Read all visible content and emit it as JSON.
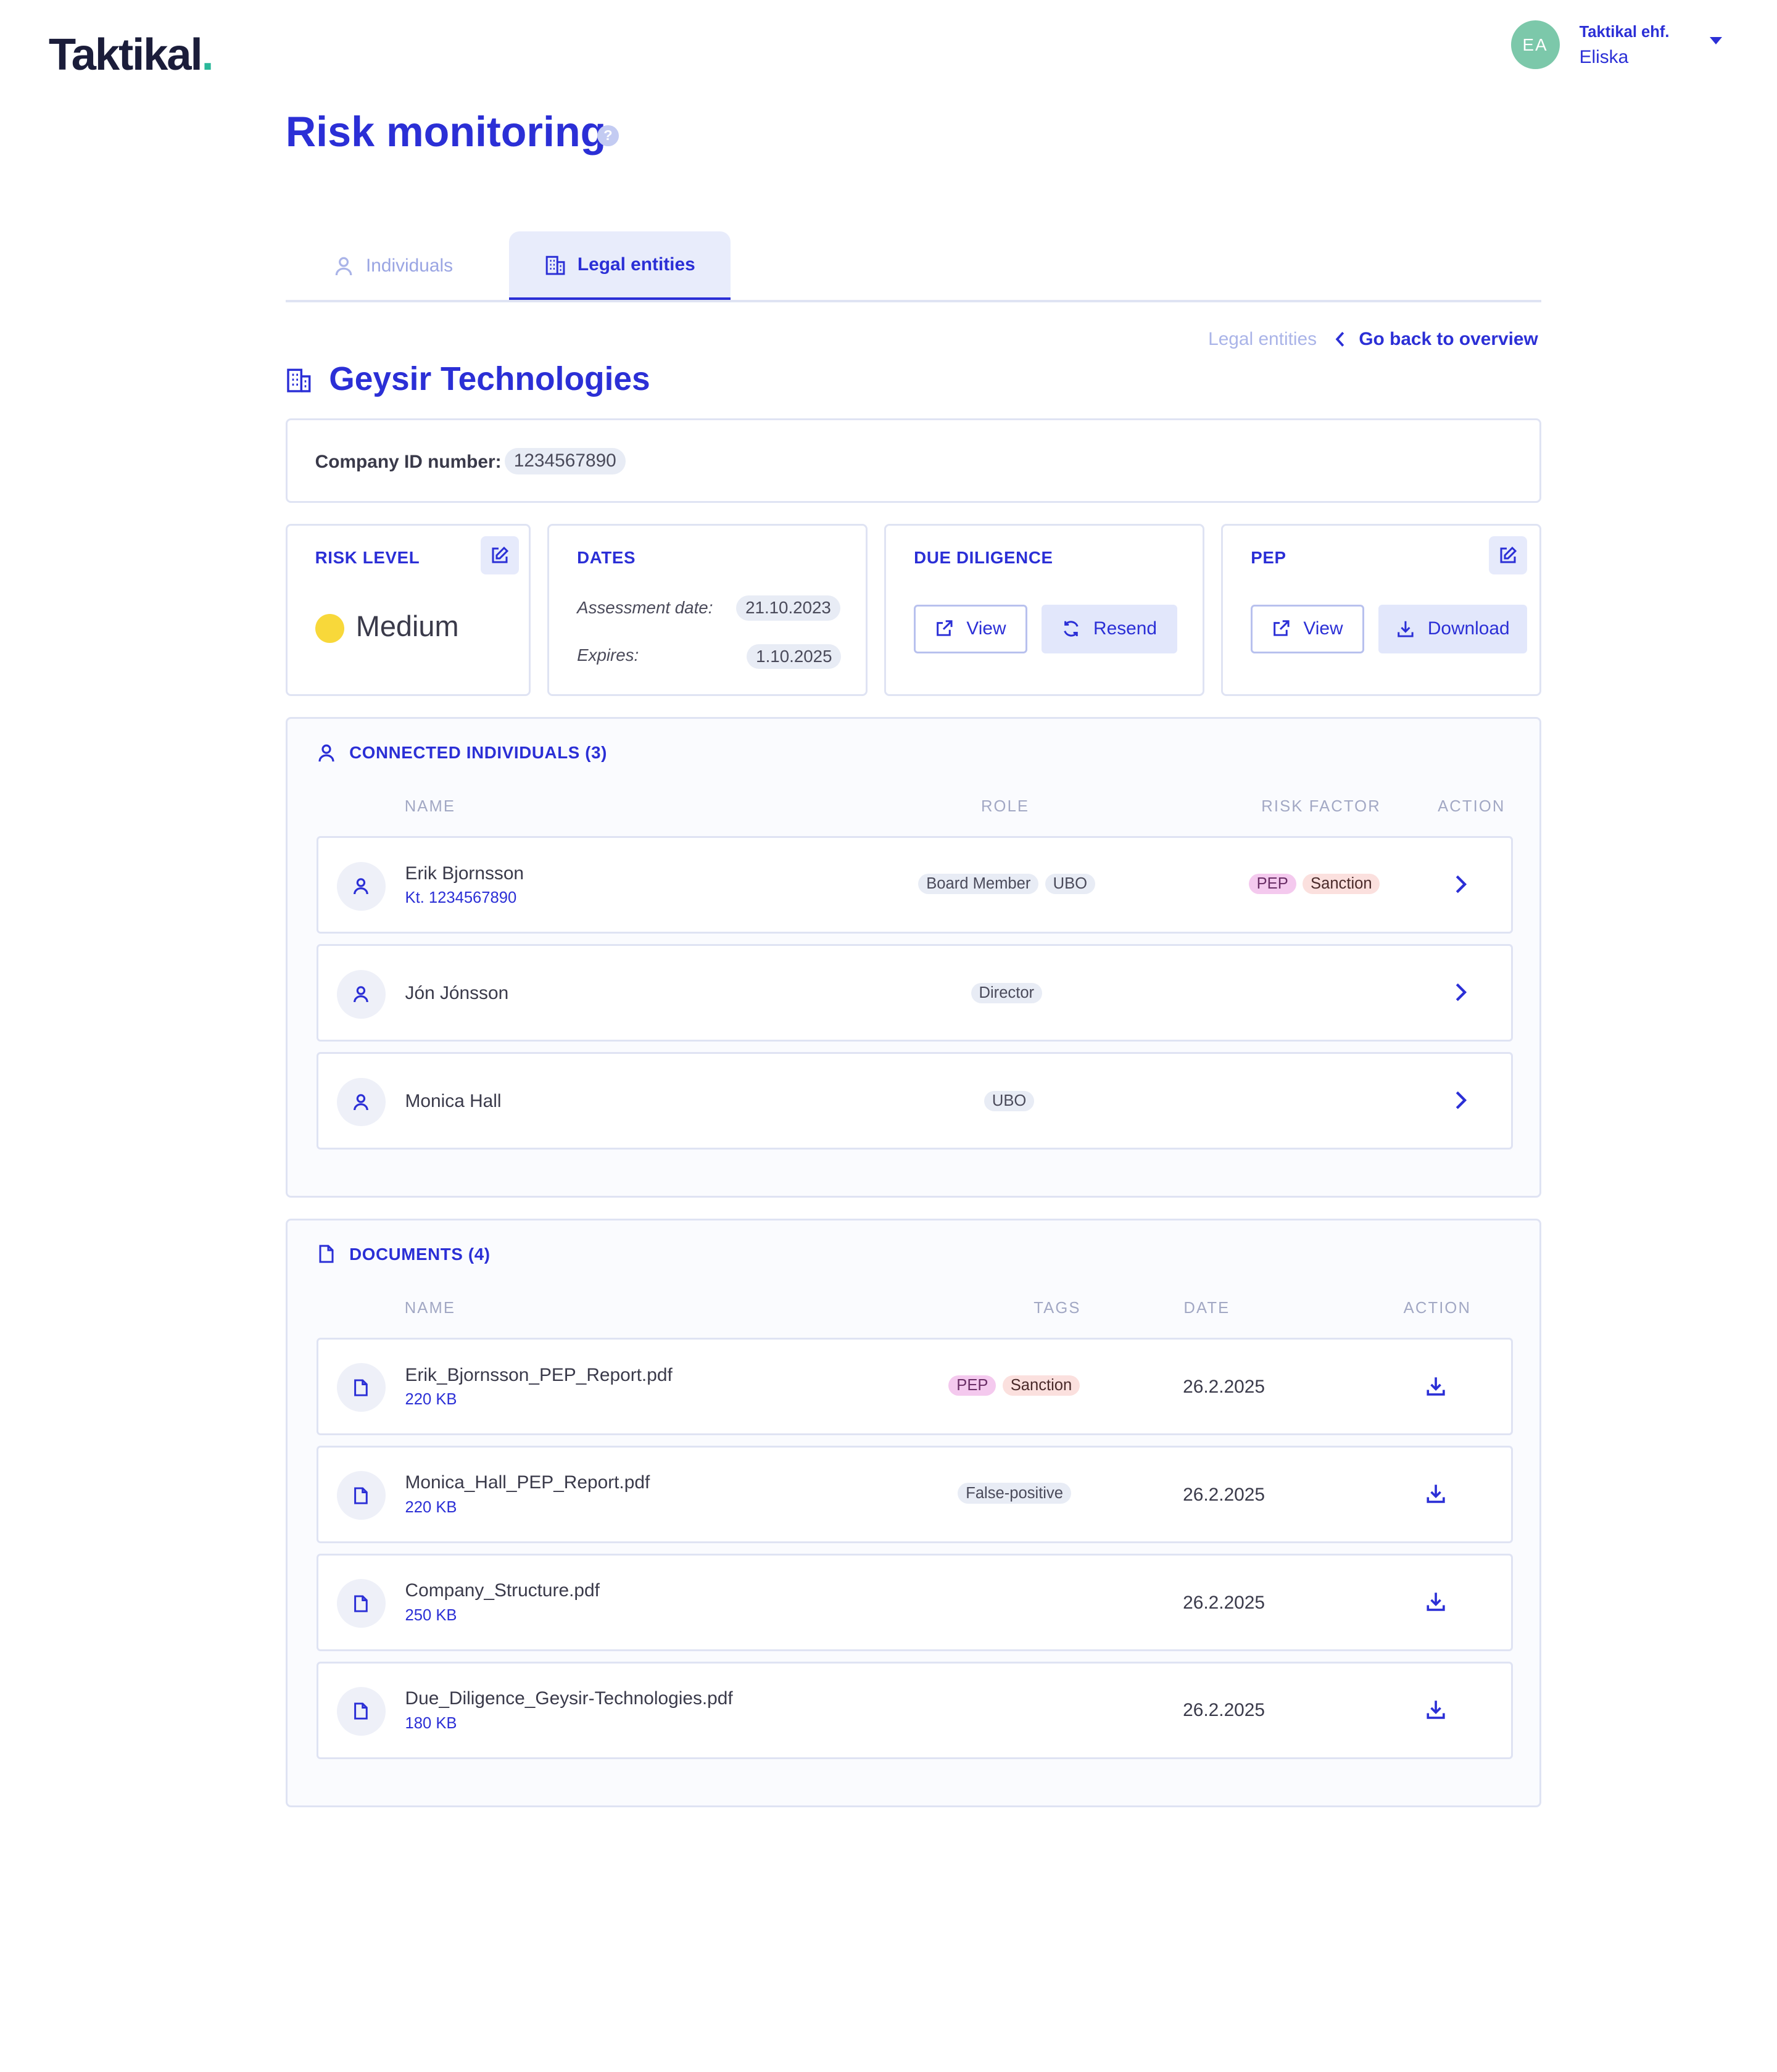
{
  "brand": {
    "logo_text": "Taktikal",
    "logo_dot": "."
  },
  "user": {
    "initials": "EA",
    "org": "Taktikal ehf.",
    "name": "Eliska"
  },
  "page": {
    "title": "Risk monitoring",
    "help": "?"
  },
  "tabs": [
    {
      "label": "Individuals",
      "active": false
    },
    {
      "label": "Legal entities",
      "active": true
    }
  ],
  "breadcrumb": {
    "previous": "Legal entities",
    "back": "Go back to overview"
  },
  "entity": {
    "name": "Geysir Technologies",
    "id_label": "Company ID number:",
    "id_value": "1234567890"
  },
  "risk": {
    "title": "RISK LEVEL",
    "level": "Medium",
    "level_color": "#f8d83a"
  },
  "dates": {
    "title": "DATES",
    "assessment_label": "Assessment date:",
    "assessment_value": "21.10.2023",
    "expires_label": "Expires:",
    "expires_value": "1.10.2025"
  },
  "due_diligence": {
    "title": "DUE DILIGENCE",
    "view": "View",
    "resend": "Resend"
  },
  "pep": {
    "title": "PEP",
    "view": "View",
    "download": "Download"
  },
  "connected": {
    "title": "CONNECTED INDIVIDUALS (3)",
    "columns": [
      "NAME",
      "ROLE",
      "RISK FACTOR",
      "ACTION"
    ],
    "rows": [
      {
        "name": "Erik Bjornsson",
        "sub": "Kt. 1234567890",
        "roles": [
          "Board Member",
          "UBO"
        ],
        "risk": [
          "PEP",
          "Sanction"
        ]
      },
      {
        "name": "Jón Jónsson",
        "roles": [
          "Director"
        ],
        "risk": []
      },
      {
        "name": "Monica Hall",
        "roles": [
          "UBO"
        ],
        "risk": []
      }
    ]
  },
  "documents": {
    "title": "DOCUMENTS (4)",
    "columns": [
      "NAME",
      "TAGS",
      "DATE",
      "ACTION"
    ],
    "rows": [
      {
        "name": "Erik_Bjornsson_PEP_Report.pdf",
        "size": "220 KB",
        "tags": [
          "PEP",
          "Sanction"
        ],
        "date": "26.2.2025"
      },
      {
        "name": "Monica_Hall_PEP_Report.pdf",
        "size": "220 KB",
        "tags": [
          "False-positive"
        ],
        "date": "26.2.2025"
      },
      {
        "name": "Company_Structure.pdf",
        "size": "250 KB",
        "tags": [],
        "date": "26.2.2025"
      },
      {
        "name": "Due_Diligence_Geysir-Technologies.pdf",
        "size": "180 KB",
        "tags": [],
        "date": "26.2.2025"
      }
    ]
  },
  "colors": {
    "accent": "#2b2fd6",
    "avatar": "#7cc8aa",
    "pep_tag": "#f4c9ee",
    "sanction_tag": "#fbe0de"
  }
}
